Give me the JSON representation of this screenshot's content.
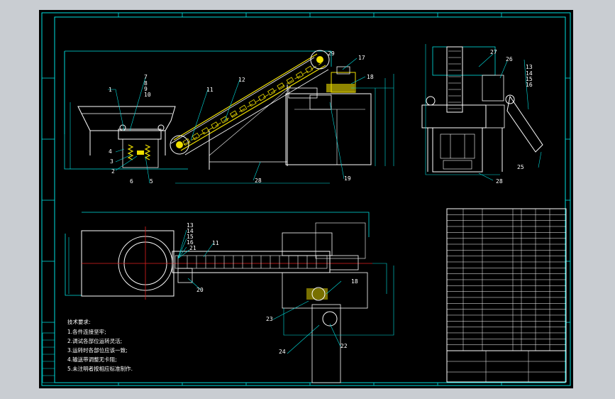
{
  "colors": {
    "background": "#000000",
    "frame": "#00e0e0",
    "part": "#ffffff",
    "yellow": "#f0e000",
    "green": "#00c800",
    "center_line": "#e02020"
  },
  "part_labels": {
    "p1": "1",
    "p2": "2",
    "p3": "3",
    "p4": "4",
    "p5": "5",
    "p6": "6",
    "p7": "7",
    "p8": "8",
    "p9": "9",
    "p10": "10",
    "p11": "11",
    "p12": "12",
    "p13": "13",
    "p14": "14",
    "p15": "15",
    "p16": "16",
    "p17": "17",
    "p18": "18",
    "p19": "19",
    "p20": "20",
    "p21": "21",
    "p22": "22",
    "p23": "23",
    "p24": "24",
    "p25": "25",
    "p26": "26",
    "p27": "27",
    "p28": "28",
    "p29": "29"
  },
  "notes": {
    "title": "技术要求:",
    "line1": "1.各件连接坚牢;",
    "line2": "2.调试各部位运转灵活;",
    "line3": "3.运转时各部位应该一致;",
    "line4": "4.输送带调整无卡阻;",
    "line5": "5.未注明者按相应标准制作."
  }
}
